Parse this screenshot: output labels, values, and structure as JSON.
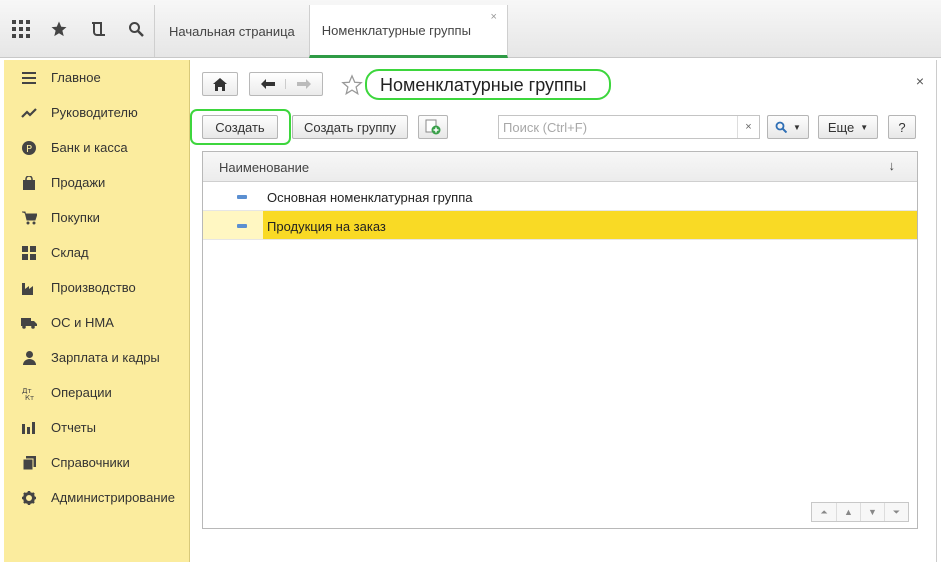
{
  "topbar": {
    "icons": [
      "apps-grid-icon",
      "favorites-star-icon",
      "history-icon",
      "search-icon"
    ],
    "tabs": [
      {
        "label": "Начальная страница",
        "active": false
      },
      {
        "label": "Номенклатурные группы",
        "active": true,
        "close": "×"
      }
    ]
  },
  "sidebar": {
    "items": [
      {
        "label": "Главное",
        "icon": "menu-lines-icon"
      },
      {
        "label": "Руководителю",
        "icon": "trend-chart-icon"
      },
      {
        "label": "Банк и касса",
        "icon": "ruble-coin-icon"
      },
      {
        "label": "Продажи",
        "icon": "shopping-bag-icon"
      },
      {
        "label": "Покупки",
        "icon": "shopping-cart-icon"
      },
      {
        "label": "Склад",
        "icon": "warehouse-grid-icon"
      },
      {
        "label": "Производство",
        "icon": "factory-icon"
      },
      {
        "label": "ОС и НМА",
        "icon": "truck-icon"
      },
      {
        "label": "Зарплата и кадры",
        "icon": "person-icon"
      },
      {
        "label": "Операции",
        "icon": "debit-credit-icon"
      },
      {
        "label": "Отчеты",
        "icon": "bar-chart-icon"
      },
      {
        "label": "Справочники",
        "icon": "books-icon"
      },
      {
        "label": "Администрирование",
        "icon": "gear-icon"
      }
    ]
  },
  "form": {
    "title": "Номенклатурные группы",
    "close": "×",
    "toolbar": {
      "create": "Создать",
      "create_group": "Создать группу",
      "search_placeholder": "Поиск (Ctrl+F)",
      "search_clear": "×",
      "more": "Еще",
      "help": "?"
    },
    "table": {
      "column": "Наименование",
      "sort": "↓",
      "rows": [
        {
          "label": "Основная номенклатурная группа",
          "selected": false
        },
        {
          "label": "Продукция на заказ",
          "selected": true
        }
      ]
    }
  },
  "colors": {
    "sidebar_bg": "#fbec9e",
    "selection": "#f9da25",
    "active_tab_accent": "#2e9b45",
    "highlight_frame": "#3dd63d"
  }
}
